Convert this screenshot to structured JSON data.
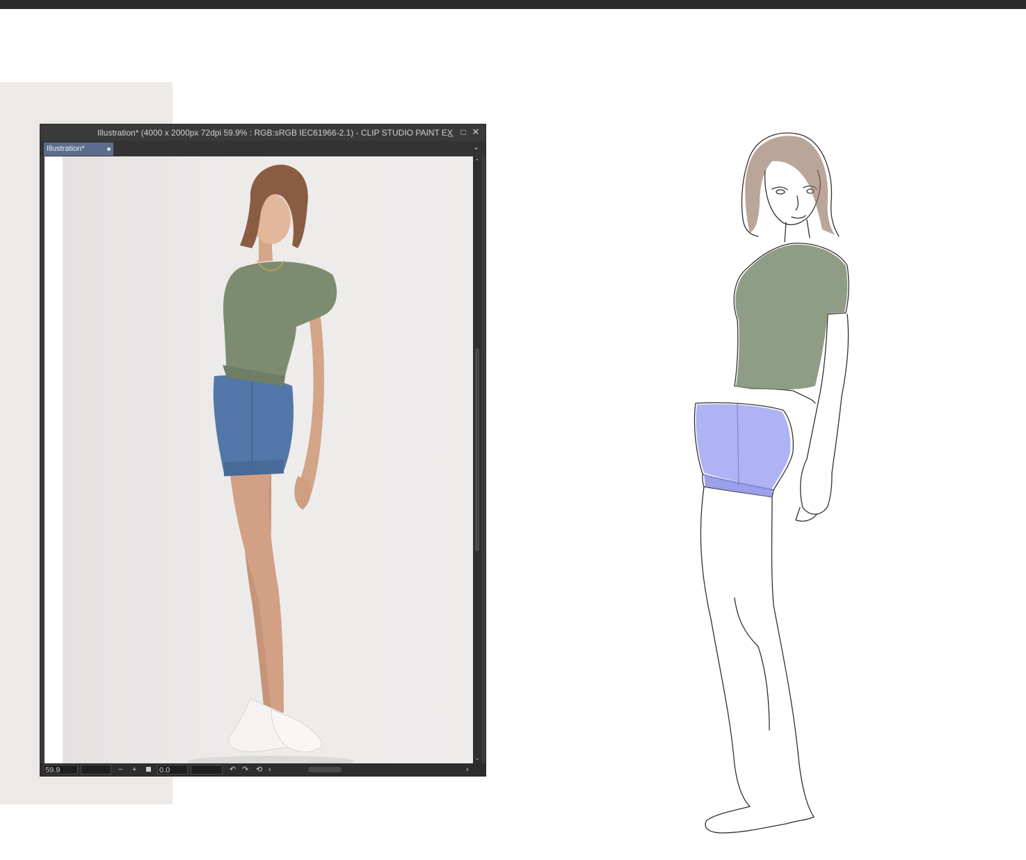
{
  "window": {
    "title": "Illustration* (4000 x 2000px 72dpi 59.9% : RGB:sRGB IEC61966-2.1)  - CLIP STUDIO PAINT EX",
    "controls": {
      "minimize": "_",
      "maximize": "□",
      "close": "✕"
    }
  },
  "tabs": [
    {
      "label": "Illustration*"
    }
  ],
  "statusbar": {
    "zoom": "59.9",
    "zoom_out": "−",
    "zoom_in": "+",
    "rotation": "0.0"
  },
  "colors": {
    "tab_active": "#5c6c8c",
    "top_shirt": "#7d8c71",
    "shorts_photo": "#5277a8",
    "shorts_sketch": "#9aa0f0",
    "hair": "#8a6a55"
  },
  "icons": [
    "minimize-icon",
    "maximize-icon",
    "close-icon",
    "tab-close-dot-icon",
    "chevron-down-icon",
    "rotate-left-icon",
    "rotate-right-icon",
    "reset-rotation-icon",
    "scroll-left-icon",
    "scroll-right-icon"
  ]
}
